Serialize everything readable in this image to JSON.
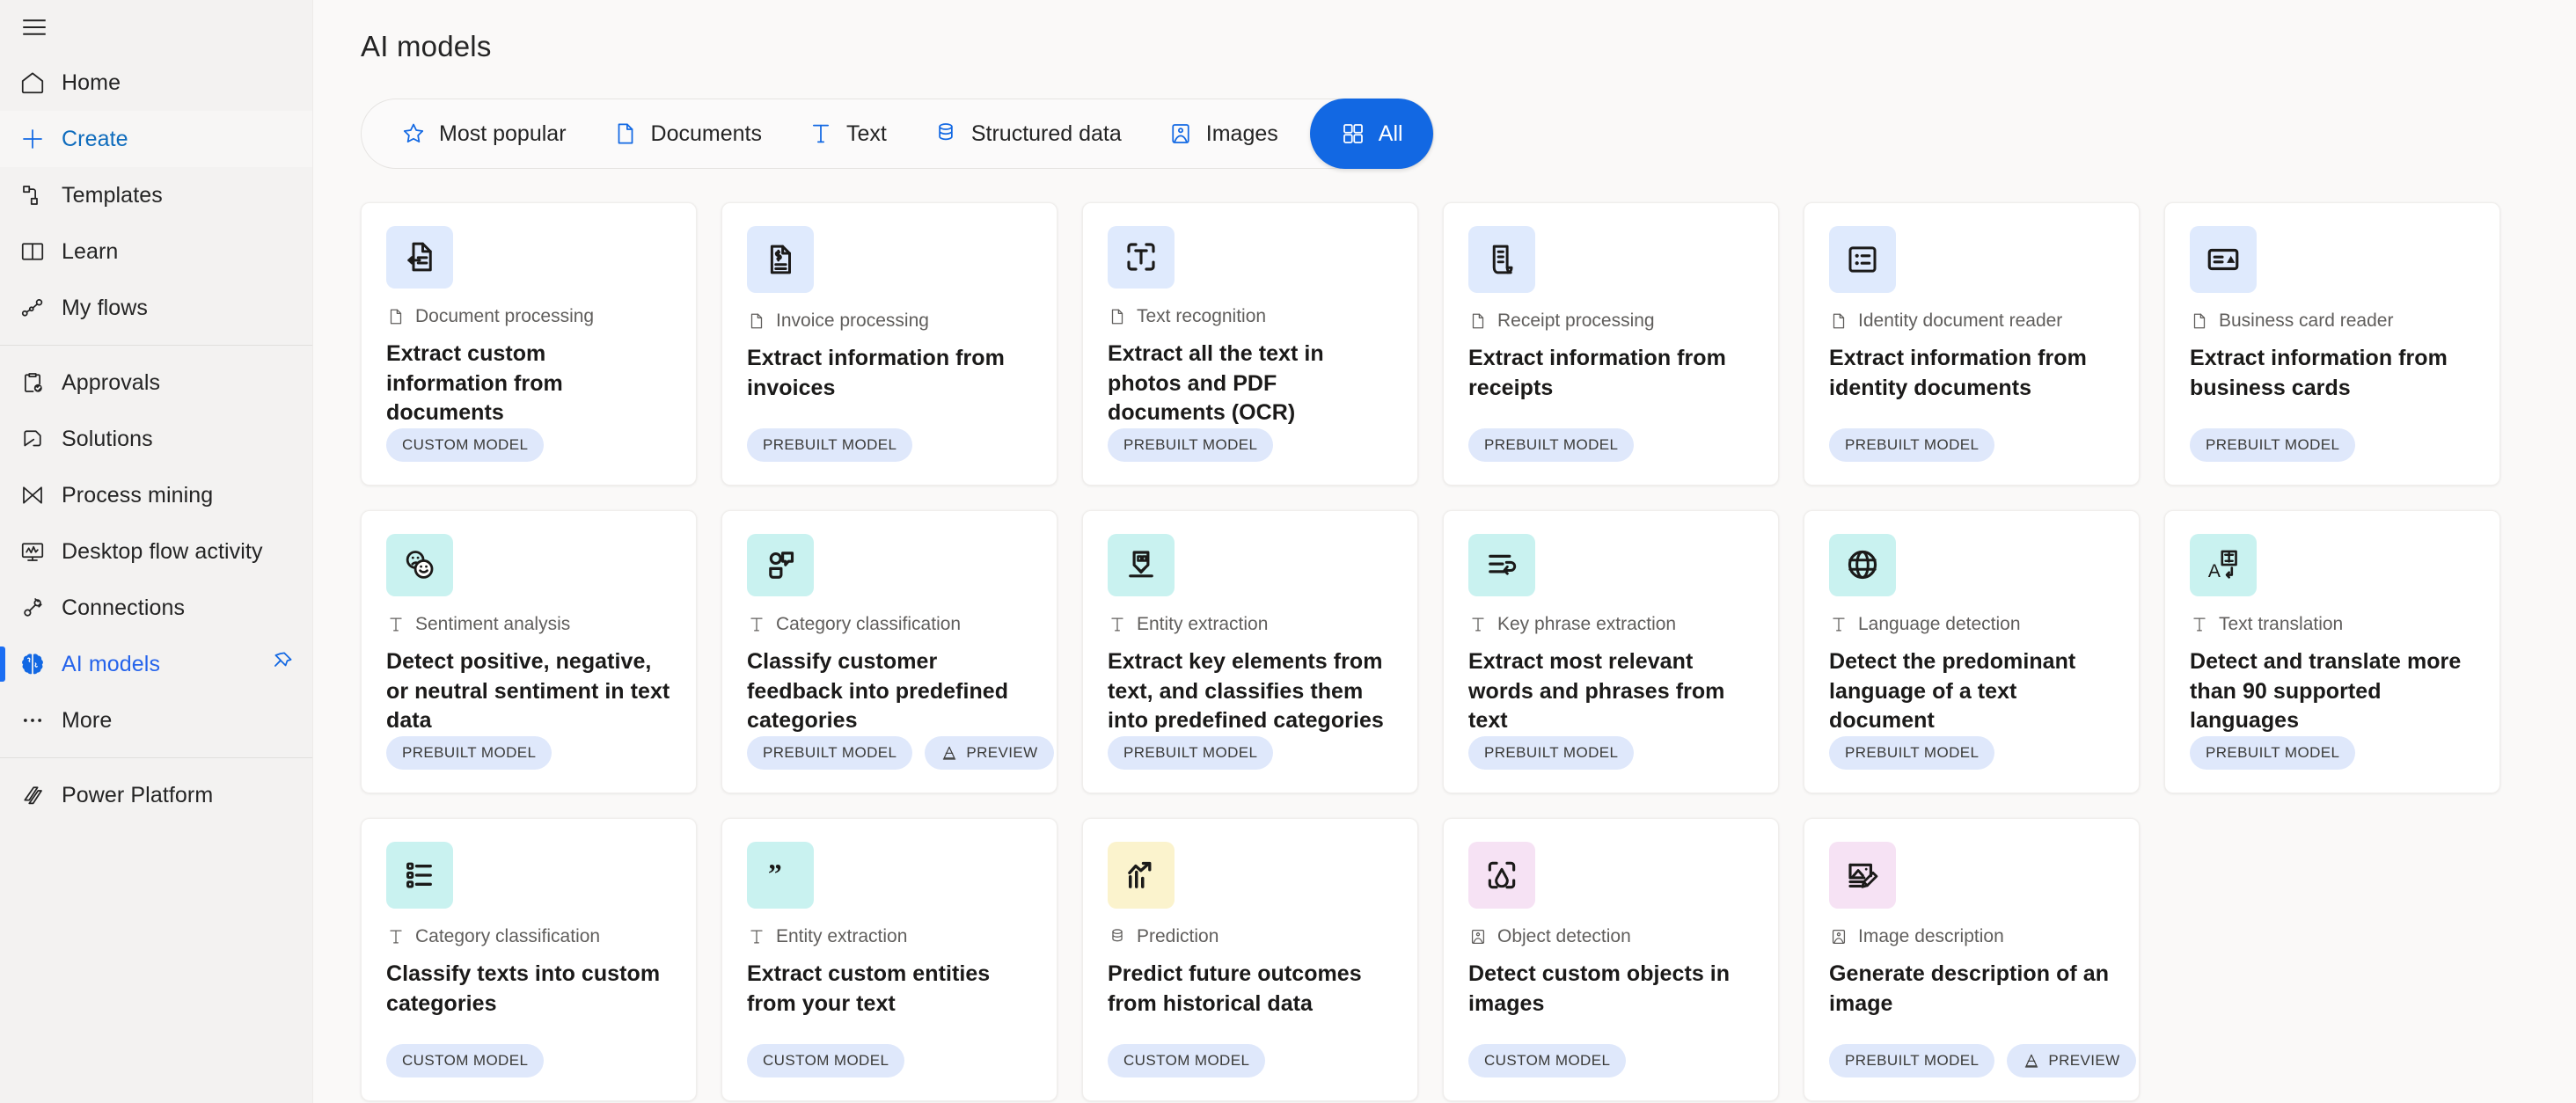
{
  "sidebar": {
    "menu_icon": "hamburger-icon",
    "groups": [
      {
        "items": [
          {
            "label": "Home",
            "icon": "home-icon",
            "state": "normal"
          },
          {
            "label": "Create",
            "icon": "plus-icon",
            "state": "selected-create"
          },
          {
            "label": "Templates",
            "icon": "templates-icon",
            "state": "normal"
          },
          {
            "label": "Learn",
            "icon": "book-icon",
            "state": "normal"
          },
          {
            "label": "My flows",
            "icon": "flow-icon",
            "state": "normal"
          }
        ]
      },
      {
        "items": [
          {
            "label": "Approvals",
            "icon": "clipboard-check-icon",
            "state": "normal"
          },
          {
            "label": "Solutions",
            "icon": "solutions-icon",
            "state": "normal"
          },
          {
            "label": "Process mining",
            "icon": "process-mining-icon",
            "state": "normal"
          },
          {
            "label": "Desktop flow activity",
            "icon": "desktop-monitor-icon",
            "state": "normal"
          },
          {
            "label": "Connections",
            "icon": "plug-icon",
            "state": "normal"
          },
          {
            "label": "AI models",
            "icon": "brain-icon",
            "state": "selected-ai",
            "pin": "pin-icon"
          },
          {
            "label": "More",
            "icon": "ellipsis-icon",
            "state": "normal"
          }
        ]
      },
      {
        "items": [
          {
            "label": "Power Platform",
            "icon": "power-platform-icon",
            "state": "normal"
          }
        ]
      }
    ]
  },
  "header": {
    "title": "AI models"
  },
  "filters": [
    {
      "label": "Most popular",
      "icon": "star-icon",
      "active": false
    },
    {
      "label": "Documents",
      "icon": "document-icon",
      "active": false
    },
    {
      "label": "Text",
      "icon": "text-t-icon",
      "active": false
    },
    {
      "label": "Structured data",
      "icon": "database-icon",
      "active": false
    },
    {
      "label": "Images",
      "icon": "image-icon",
      "active": false
    },
    {
      "label": "All",
      "icon": "grid-icon",
      "active": true
    }
  ],
  "colors": {
    "accent": "#1268e3",
    "sidebar_bg": "#f3f2f1",
    "page_bg": "#faf9f8",
    "icon_blue": "#dfeafd",
    "icon_teal": "#c9f2f0",
    "icon_yellow": "#fbf3cd",
    "icon_pink": "#f6e2f4",
    "tag_bg": "#dfe8fb"
  },
  "cards": [
    {
      "kind": "Document processing",
      "kind_icon": "document-icon",
      "title": "Extract custom information from documents",
      "icon": "document-extract-icon",
      "icon_bg": "#dfeafd",
      "tags": [
        {
          "label": "CUSTOM MODEL"
        }
      ]
    },
    {
      "kind": "Invoice processing",
      "kind_icon": "document-icon",
      "title": "Extract information from invoices",
      "icon": "invoice-icon",
      "icon_bg": "#dfeafd",
      "tags": [
        {
          "label": "PREBUILT MODEL"
        }
      ]
    },
    {
      "kind": "Text recognition",
      "kind_icon": "document-icon",
      "title": "Extract all the text in photos and PDF documents (OCR)",
      "icon": "text-scan-icon",
      "icon_bg": "#dfeafd",
      "tags": [
        {
          "label": "PREBUILT MODEL"
        }
      ]
    },
    {
      "kind": "Receipt processing",
      "kind_icon": "document-icon",
      "title": "Extract information from receipts",
      "icon": "receipt-icon",
      "icon_bg": "#dfeafd",
      "tags": [
        {
          "label": "PREBUILT MODEL"
        }
      ]
    },
    {
      "kind": "Identity document reader",
      "kind_icon": "document-icon",
      "title": "Extract information from identity documents",
      "icon": "id-card-icon",
      "icon_bg": "#dfeafd",
      "tags": [
        {
          "label": "PREBUILT MODEL"
        }
      ]
    },
    {
      "kind": "Business card reader",
      "kind_icon": "document-icon",
      "title": "Extract information from business cards",
      "icon": "business-card-icon",
      "icon_bg": "#dfeafd",
      "tags": [
        {
          "label": "PREBUILT MODEL"
        }
      ]
    },
    {
      "kind": "Sentiment analysis",
      "kind_icon": "text-t-icon",
      "title": "Detect positive, negative, or neutral sentiment in text data",
      "icon": "sentiment-faces-icon",
      "icon_bg": "#c9f2f0",
      "tags": [
        {
          "label": "PREBUILT MODEL"
        }
      ]
    },
    {
      "kind": "Category classification",
      "kind_icon": "text-t-icon",
      "title": "Classify customer feedback into predefined categories",
      "icon": "feedback-bubbles-icon",
      "icon_bg": "#c9f2f0",
      "tags": [
        {
          "label": "PREBUILT MODEL"
        },
        {
          "label": "PREVIEW",
          "icon": "preview-cone-icon"
        }
      ]
    },
    {
      "kind": "Entity extraction",
      "kind_icon": "text-t-icon",
      "title": "Extract key elements from text, and classifies them into predefined categories",
      "icon": "entity-quote-icon",
      "icon_bg": "#c9f2f0",
      "tags": [
        {
          "label": "PREBUILT MODEL"
        }
      ]
    },
    {
      "kind": "Key phrase extraction",
      "kind_icon": "text-t-icon",
      "title": "Extract most relevant words and phrases from text",
      "icon": "key-phrase-icon",
      "icon_bg": "#c9f2f0",
      "tags": [
        {
          "label": "PREBUILT MODEL"
        }
      ]
    },
    {
      "kind": "Language detection",
      "kind_icon": "text-t-icon",
      "title": "Detect the predominant language of a text document",
      "icon": "globe-icon",
      "icon_bg": "#c9f2f0",
      "tags": [
        {
          "label": "PREBUILT MODEL"
        }
      ]
    },
    {
      "kind": "Text translation",
      "kind_icon": "text-t-icon",
      "title": "Detect and translate more than 90 supported languages",
      "icon": "translate-icon",
      "icon_bg": "#c9f2f0",
      "tags": [
        {
          "label": "PREBUILT MODEL"
        }
      ]
    },
    {
      "kind": "Category classification",
      "kind_icon": "text-t-icon",
      "title": "Classify texts into custom categories",
      "icon": "bullet-list-icon",
      "icon_bg": "#c9f2f0",
      "tags": [
        {
          "label": "CUSTOM MODEL"
        }
      ]
    },
    {
      "kind": "Entity extraction",
      "kind_icon": "text-t-icon",
      "title": "Extract custom entities from your text",
      "icon": "quote-marks-icon",
      "icon_bg": "#c9f2f0",
      "tags": [
        {
          "label": "CUSTOM MODEL"
        }
      ]
    },
    {
      "kind": "Prediction",
      "kind_icon": "database-icon",
      "title": "Predict future outcomes from historical data",
      "icon": "trend-chart-icon",
      "icon_bg": "#fbf3cd",
      "tags": [
        {
          "label": "CUSTOM MODEL"
        }
      ]
    },
    {
      "kind": "Object detection",
      "kind_icon": "image-icon",
      "title": "Detect custom objects in images",
      "icon": "object-scan-icon",
      "icon_bg": "#f6e2f4",
      "tags": [
        {
          "label": "CUSTOM MODEL"
        }
      ]
    },
    {
      "kind": "Image description",
      "kind_icon": "image-icon",
      "title": "Generate description of an image",
      "icon": "image-edit-icon",
      "icon_bg": "#f6e2f4",
      "tags": [
        {
          "label": "PREBUILT MODEL"
        },
        {
          "label": "PREVIEW",
          "icon": "preview-cone-icon"
        }
      ]
    }
  ]
}
